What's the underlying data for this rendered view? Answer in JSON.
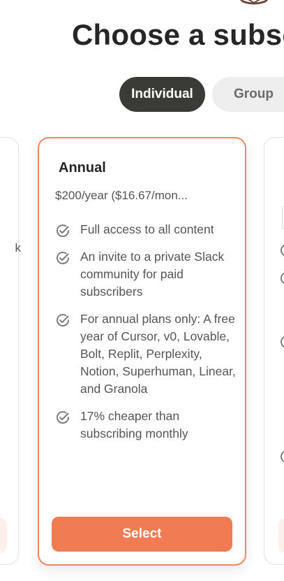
{
  "header": {
    "title": "Choose a subscription"
  },
  "plan_toggle": {
    "individual_label": "Individual",
    "group_label": "Group",
    "selected": "Individual"
  },
  "prev_card": {
    "peek_text": "k"
  },
  "annual_plan": {
    "name": "Annual",
    "price": "$200/year ($16.67/mon...",
    "features": [
      "Full access to all content",
      "An invite to a private Slack community for paid subscribers",
      "For annual plans only: A free year of Cursor, v0, Lovable, Bolt, Replit, Perplexity, Notion, Superhuman, Linear, and Granola",
      "17% cheaper than subscribing monthly"
    ],
    "select_label": "Select",
    "check_icon": "check-circle-icon"
  },
  "colors": {
    "accent": "#f17c53",
    "card_border": "#ef8661",
    "toggle_active": "#3a3a37",
    "toggle_inactive": "#eeeeee",
    "text_muted": "#555555"
  }
}
